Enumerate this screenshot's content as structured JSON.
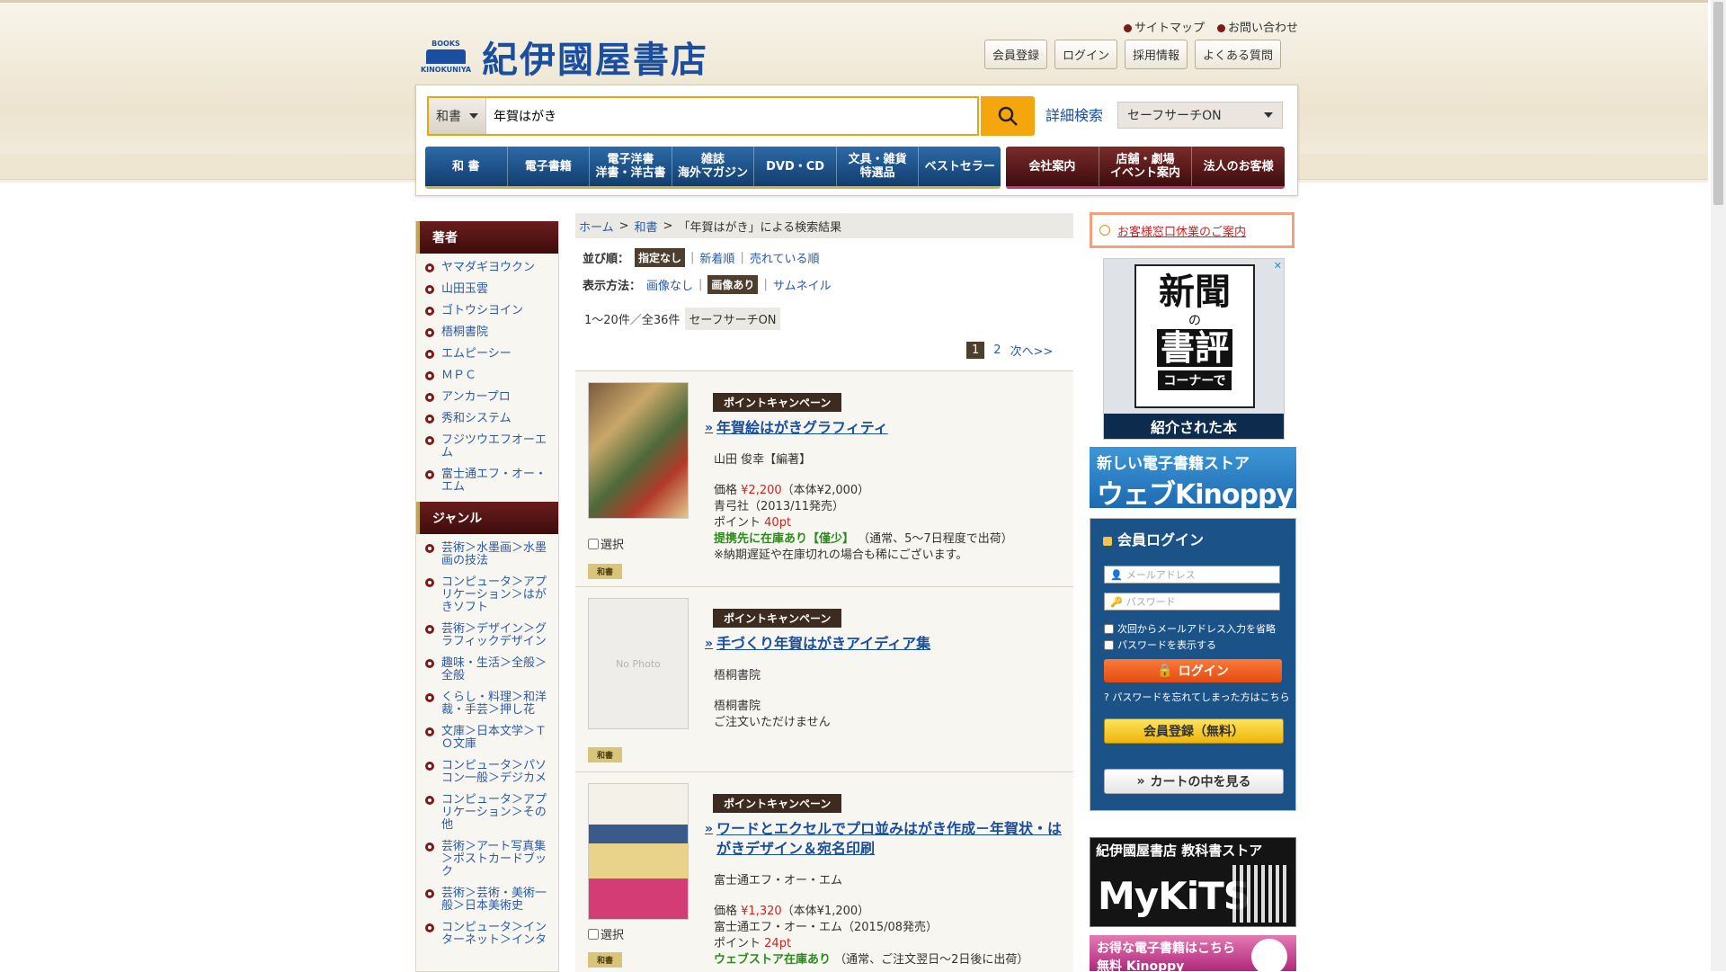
{
  "header": {
    "logo_small": "BOOKS",
    "logo_small2": "KINOKUNIYA",
    "logo_text": "紀伊國屋書店",
    "toplinks": [
      "サイトマップ",
      "お問い合わせ"
    ],
    "buttons": [
      "会員登録",
      "ログイン",
      "採用情報",
      "よくある質問"
    ]
  },
  "search": {
    "category": "和書",
    "query": "年賀はがき",
    "advanced_label": "詳細検索",
    "safe_search": "セーフサーチON"
  },
  "nav": {
    "primary": [
      "和 書",
      "電子書籍",
      "電子洋書\n洋書・洋古書",
      "雑誌\n海外マガジン",
      "DVD・CD",
      "文具・雑貨\n特選品",
      "ベストセラー"
    ],
    "secondary": [
      "会社案内",
      "店舗・劇場\nイベント案内",
      "法人のお客様"
    ]
  },
  "sidebar": {
    "author_heading": "著者",
    "authors": [
      "ヤマダギヨウクン",
      "山田玉雲",
      "ゴトウシヨイン",
      "梧桐書院",
      "エムピーシー",
      "ＭＰＣ",
      "アンカープロ",
      "秀和システム",
      "フジツウエフオーエム",
      "富士通エフ・オー・エム"
    ],
    "genre_heading": "ジャンル",
    "genres": [
      "芸術＞水墨画＞水墨画の技法",
      "コンピュータ＞アプリケーション＞はがきソフト",
      "芸術＞デザイン＞グラフィックデザイン",
      "趣味・生活＞全般＞全般",
      "くらし・料理＞和洋裁・手芸＞押し花",
      "文庫＞日本文学＞ＴＯ文庫",
      "コンピュータ＞パソコン一般＞デジカメ",
      "コンピュータ＞アプリケーション＞その他",
      "芸術＞アート写真集＞ポストカードブック",
      "芸術＞芸術・美術一般＞日本美術史",
      "コンピュータ＞インターネット＞インタ"
    ]
  },
  "breadcrumb": {
    "home": "ホーム",
    "cat": "和書",
    "current": "「年賀はがき」による検索結果",
    "sep": ">"
  },
  "sort": {
    "label": "並び順：",
    "options": [
      "指定なし",
      "新着順",
      "売れている順"
    ],
    "display_label": "表示方法：",
    "display_options": [
      "画像なし",
      "画像あり",
      "サムネイル"
    ]
  },
  "results_meta": {
    "count": "1～20件／全36件",
    "safe": "セーフサーチON",
    "pages": [
      "1",
      "2"
    ],
    "next": "次へ>>"
  },
  "results": [
    {
      "campaign": "ポイントキャンペーン",
      "title": "年賀絵はがきグラフィティ",
      "author": "山田 俊幸【編著】",
      "price_label": "価格",
      "price": "¥2,200",
      "price_note": "（本体¥2,000）",
      "publisher": "青弓社（2013/11発売）",
      "point_label": "ポイント",
      "points": "40pt",
      "stock": "提携先に在庫あり【僅少】",
      "stock_note": "（通常、5～7日程度で出荷）",
      "note": "※納期遅延や在庫切れの場合も稀にございます。",
      "select": "選択",
      "tag": "和書"
    },
    {
      "campaign": "ポイントキャンペーン",
      "title": "手づくり年賀はがきアイディア集",
      "author": "梧桐書院",
      "publisher": "梧桐書院",
      "note": "ご注文いただけません",
      "no_photo": "No Photo",
      "tag": "和書"
    },
    {
      "campaign": "ポイントキャンペーン",
      "title": "ワードとエクセルでプロ並みはがき作成－年賀状・はがきデザイン＆宛名印刷",
      "author": "富士通エフ・オー・エム",
      "price_label": "価格",
      "price": "¥1,320",
      "price_note": "（本体¥1,200）",
      "publisher": "富士通エフ・オー・エム（2015/08発売）",
      "point_label": "ポイント",
      "points": "24pt",
      "stock": "ウェブストア在庫あり",
      "stock_note": "（通常、ご注文翌日～2日後に出荷）",
      "select": "選択",
      "tag": "和書"
    }
  ],
  "right": {
    "notice": "お客様窓口休業のご案内",
    "ad1": {
      "l1": "新聞",
      "l2": "の",
      "l3": "書評",
      "l4": "コーナーで",
      "ribbon": "紹介された本"
    },
    "ad2": {
      "l1": "新しい電子書籍ストア",
      "l2": "ウェブKinoppy"
    },
    "login": {
      "heading": "会員ログイン",
      "email_ph": "メールアドレス",
      "password_ph": "パスワード",
      "remember": "次回からメールアドレス入力を省略",
      "show_password": "パスワードを表示する",
      "login_btn": "ログイン",
      "forgot": "パスワードを忘れてしまった方はこちら",
      "register_btn": "会員登録（無料）",
      "cart_btn": "カートの中を見る"
    },
    "ad3": {
      "l1": "紀伊國屋書店 教科書ストア",
      "l2": "MyKiTS"
    },
    "ad4": {
      "l1": "お得な電子書籍はこちら",
      "l2": "無料 Kinoppy"
    }
  },
  "colors": {
    "brand_blue": "#1a4e9e",
    "nav_blue": "#2c6aa8",
    "nav_maroon": "#7a2b2b",
    "search_accent": "#f5a60c",
    "price_red": "#d62020",
    "stock_green": "#2d8a1e"
  }
}
